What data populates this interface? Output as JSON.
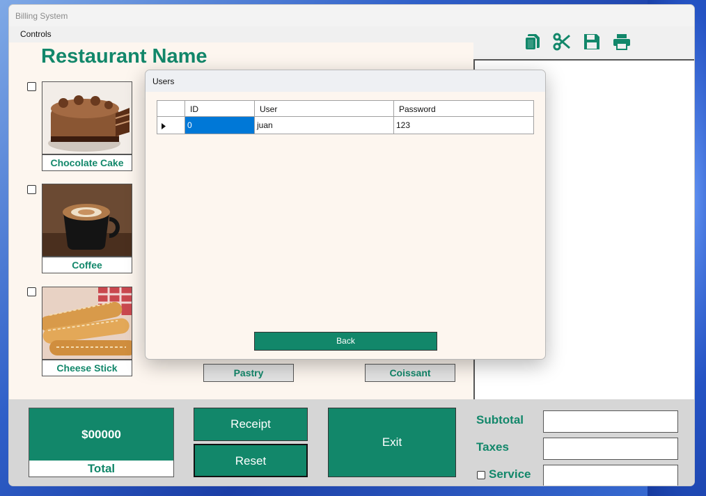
{
  "window": {
    "title": "Billing System"
  },
  "menu": {
    "controls": "Controls"
  },
  "toolbar": {
    "icons": [
      "copy-icon",
      "cut-icon",
      "save-icon",
      "print-icon"
    ],
    "accent": "#12876a"
  },
  "main": {
    "restaurant_name": "Restaurant Name",
    "items": [
      {
        "label": "Chocolate Cake",
        "checked": false
      },
      {
        "label": "Coffee",
        "checked": false
      },
      {
        "label": "Cheese Stick",
        "checked": false
      }
    ],
    "extra_labels": [
      "Pastry",
      "Coissant"
    ]
  },
  "bottom": {
    "total_value": "$00000",
    "total_label": "Total",
    "receipt_label": "Receipt",
    "reset_label": "Reset",
    "exit_label": "Exit",
    "subtotal_label": "Subtotal",
    "taxes_label": "Taxes",
    "service_label": "Service",
    "subtotal_value": "",
    "taxes_value": "",
    "service_value": ""
  },
  "dialog": {
    "title": "Users",
    "columns": [
      "ID",
      "User",
      "Password"
    ],
    "rows": [
      {
        "id": "0",
        "user": "juan",
        "password": "123"
      }
    ],
    "back_label": "Back"
  }
}
